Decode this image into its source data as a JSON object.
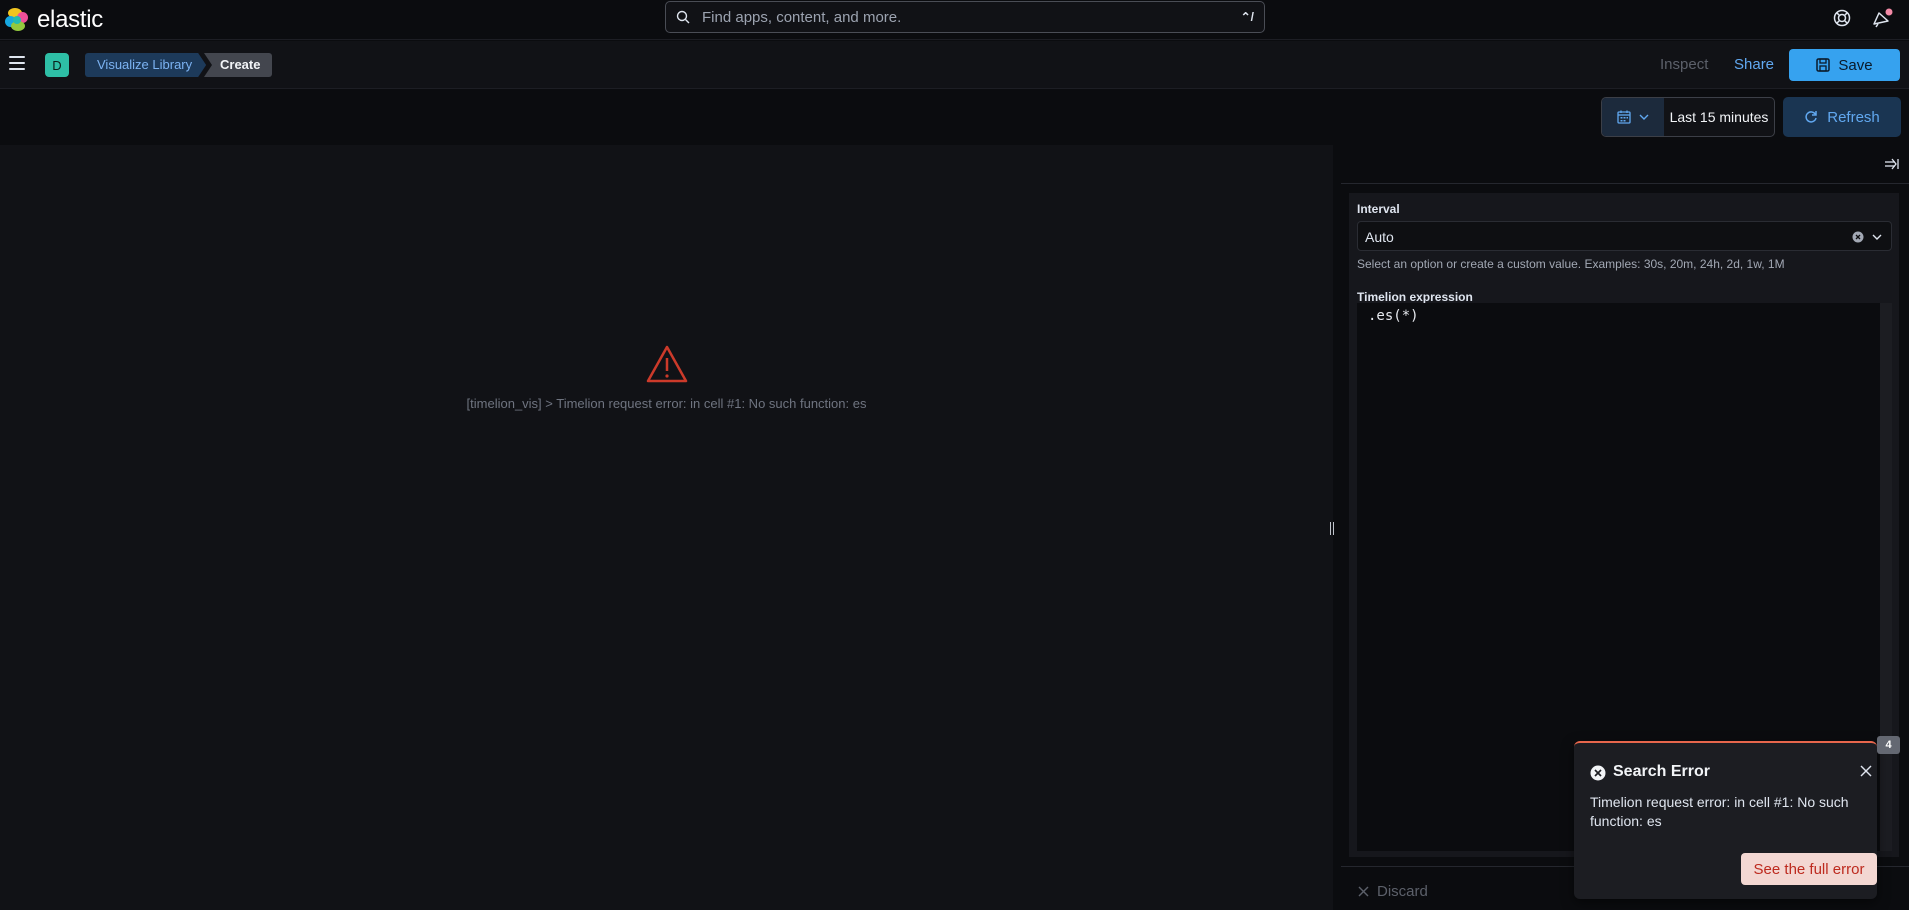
{
  "header": {
    "brand": "elastic",
    "search_placeholder": "Find apps, content, and more.",
    "search_shortcut": "⌃/",
    "icons": [
      "help-icon",
      "newsfeed-icon"
    ]
  },
  "nav": {
    "space_initial": "D",
    "breadcrumbs": [
      "Visualize Library",
      "Create"
    ],
    "inspect_label": "Inspect",
    "share_label": "Share",
    "save_label": "Save"
  },
  "query": {
    "date_range": "Last 15 minutes",
    "refresh_label": "Refresh"
  },
  "visualization": {
    "error_message": "[timelion_vis] > Timelion request error: in cell #1: No such function: es"
  },
  "editor": {
    "interval_label": "Interval",
    "interval_value": "Auto",
    "interval_help": "Select an option or create a custom value. Examples: 30s, 20m, 24h, 2d, 1w, 1M",
    "expression_label": "Timelion expression",
    "expression_value": ".es(*)",
    "discard_label": "Discard"
  },
  "toast": {
    "count": "4",
    "title": "Search Error",
    "body": "Timelion request error: in cell #1: No such function: es",
    "button_label": "See the full error"
  },
  "colors": {
    "primary": "#36a2ef",
    "danger": "#e7664c",
    "space_badge": "#2ebfa6"
  }
}
